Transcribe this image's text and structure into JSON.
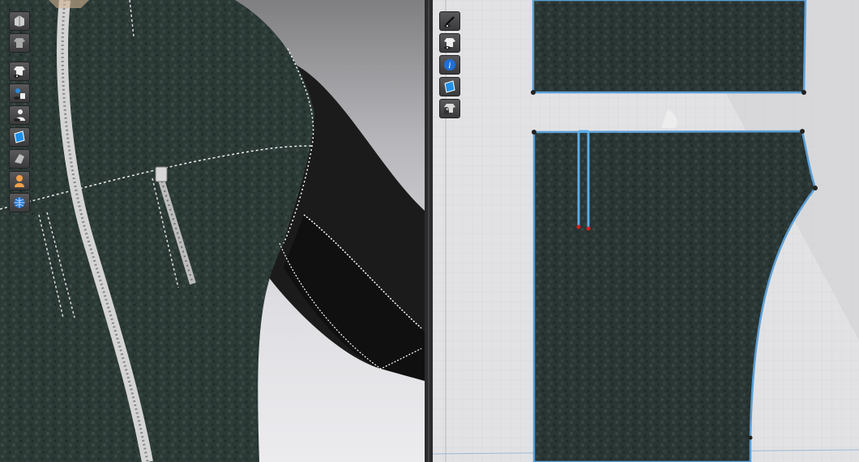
{
  "app": {
    "title": ""
  },
  "colors": {
    "fabric": "#2c3a36",
    "fabric_dark": "#1e2927",
    "sleeve": "#1b1b1b",
    "pattern_outline": "#5b9fd6",
    "zipper": "#c9c9c9",
    "grid_bg": "#e2e2e4"
  },
  "toolbar_3d": {
    "buttons": [
      {
        "icon": "avatar-display-icon"
      },
      {
        "icon": "garment-display-icon"
      },
      {
        "icon": "show-garment-icon"
      },
      {
        "icon": "show-avatar-icon"
      },
      {
        "icon": "show-avatar-silhouette-icon"
      },
      {
        "icon": "texture-display-icon"
      },
      {
        "icon": "shaded-display-icon"
      },
      {
        "icon": "avatar-skin-icon"
      },
      {
        "icon": "environment-icon"
      }
    ]
  },
  "toolbar_2d": {
    "buttons": [
      {
        "icon": "show-sewing-icon"
      },
      {
        "icon": "show-pattern-icon"
      },
      {
        "icon": "info-icon"
      },
      {
        "icon": "pattern-texture-icon"
      },
      {
        "icon": "lock-pattern-icon"
      }
    ]
  }
}
